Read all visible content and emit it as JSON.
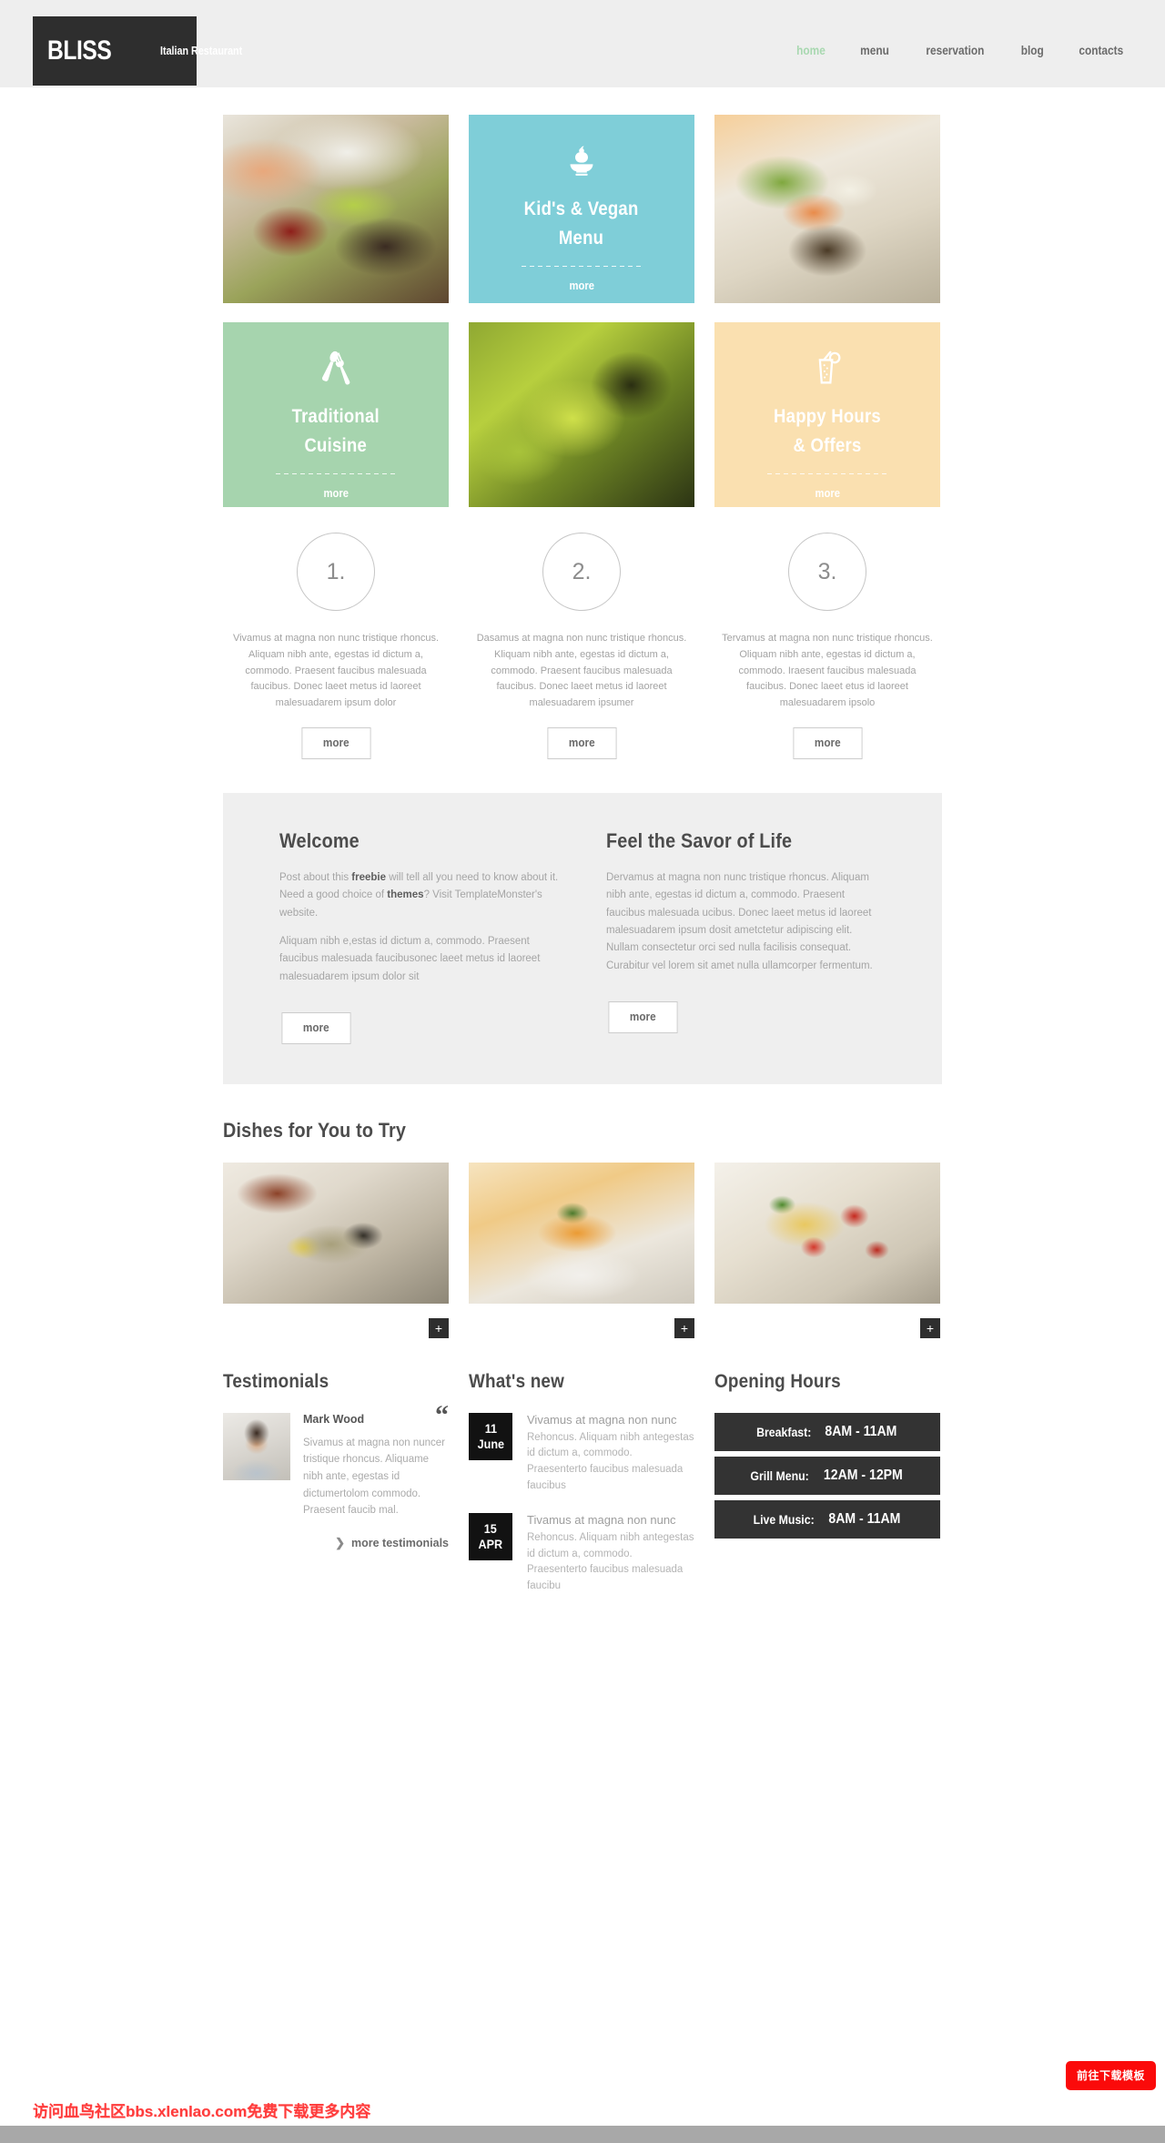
{
  "header": {
    "logo_name": "BLISS",
    "logo_tagline": "Italian Restaurant",
    "nav": [
      {
        "label": "home",
        "active": true
      },
      {
        "label": "menu",
        "active": false
      },
      {
        "label": "reservation",
        "active": false
      },
      {
        "label": "blog",
        "active": false
      },
      {
        "label": "contacts",
        "active": false
      }
    ]
  },
  "tiles": {
    "kids_vegan": {
      "title_line1": "Kid's & Vegan",
      "title_line2": "Menu",
      "more": "more",
      "icon": "apple-on-plate-icon",
      "bg_color": "#7fced8"
    },
    "traditional": {
      "title_line1": "Traditional",
      "title_line2": "Cuisine",
      "more": "more",
      "icon": "spoon-fork-crossed-icon",
      "bg_color": "#a6d4ae"
    },
    "happy_hours": {
      "title_line1": "Happy Hours",
      "title_line2": "& Offers",
      "more": "more",
      "icon": "cocktail-glass-icon",
      "bg_color": "#fae0b0"
    },
    "photo_salmon_alt": "salmon-and-greens-dish-photo",
    "photo_shrimp_alt": "shrimp-risotto-dish-photo",
    "photo_greens_alt": "green-vegetables-photo"
  },
  "steps": [
    {
      "number": "1.",
      "text": "Vivamus at magna non nunc tristique rhoncus. Aliquam nibh ante, egestas id dictum a, commodo. Praesent faucibus malesuada faucibus. Donec laeet metus id laoreet malesuadarem ipsum dolor",
      "more": "more"
    },
    {
      "number": "2.",
      "text": "Dasamus at magna non nunc tristique rhoncus. Kliquam nibh ante, egestas id dictum a, commodo. Praesent faucibus malesuada faucibus. Donec laeet metus id laoreet malesuadarem ipsumer",
      "more": "more"
    },
    {
      "number": "3.",
      "text": "Tervamus at magna non nunc tristique rhoncus. Oliquam nibh ante, egestas id dictum a, commodo. Iraesent faucibus malesuada faucibus. Donec laeet etus id laoreet malesuadarem ipsolo",
      "more": "more"
    }
  ],
  "welcome": {
    "title": "Welcome",
    "para1_pre": "Post about this ",
    "para1_b1": "freebie",
    "para1_mid": " will tell all you need to know about it. Need a good choice of ",
    "para1_b2": "themes",
    "para1_post": "? Visit TemplateMonster's website.",
    "para2": "Aliquam nibh e,estas id dictum a, commodo. Praesent faucibus malesuada faucibusonec laeet metus id laoreet malesuadarem ipsum dolor sit",
    "more": "more"
  },
  "savor": {
    "title": "Feel the Savor of Life",
    "para": "Dervamus at magna non nunc tristique rhoncus. Aliquam nibh ante, egestas id dictum a, commodo. Praesent faucibus malesuada ucibus. Donec laeet metus id laoreet malesuadarem ipsum dosit ametctetur adipiscing elit. Nullam consectetur orci sed nulla facilisis consequat. Curabitur vel lorem sit amet nulla ullamcorper fermentum.",
    "more": "more"
  },
  "dishes": {
    "title": "Dishes for You to Try",
    "items": [
      {
        "alt": "seafood-platter-photo",
        "plus": "+"
      },
      {
        "alt": "orange-dessert-tart-photo",
        "plus": "+"
      },
      {
        "alt": "spaghetti-tomato-photo",
        "plus": "+"
      }
    ]
  },
  "testimonials": {
    "title": "Testimonials",
    "author": "Mark Wood",
    "text": "Sivamus at magna non nuncer tristique rhoncus. Aliquame nibh ante, egestas id dictumertolom commodo. Praesent faucib mal.",
    "quote_glyph": "“",
    "more_link": "more testimonials",
    "chevron": "❯",
    "avatar_alt": "mark-wood-portrait"
  },
  "whats_new": {
    "title": "What's new",
    "items": [
      {
        "day": "11",
        "month": "June",
        "title": "Vivamus at magna non nunc",
        "body": "Rehoncus. Aliquam nibh antegestas id dictum a, commodo. Praesenterto faucibus malesuada faucibus"
      },
      {
        "day": "15",
        "month": "APR",
        "title": "Tivamus at magna non nunc",
        "body": "Rehoncus. Aliquam nibh antegestas id dictum a, commodo. Praesenterto faucibus malesuada faucibu"
      }
    ]
  },
  "opening_hours": {
    "title": "Opening Hours",
    "rows": [
      {
        "label": "Breakfast:",
        "time": "8AM - 11AM"
      },
      {
        "label": "Grill Menu:",
        "time": "12AM - 12PM"
      },
      {
        "label": "Live Music:",
        "time": "8AM - 11AM"
      }
    ]
  },
  "overlay": {
    "download_button": "前往下载模板",
    "watermark": "访问血鸟社区bbs.xlenlao.com免费下载更多内容"
  }
}
